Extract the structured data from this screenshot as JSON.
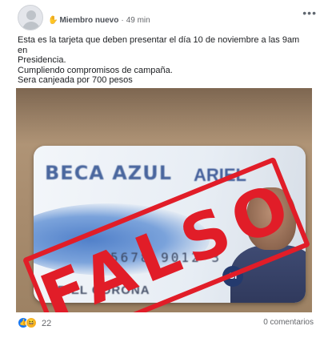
{
  "post": {
    "author_badge_icon": "hand-icon",
    "author_badge": "Miembro nuevo",
    "separator": "·",
    "timestamp": "49 min",
    "menu_icon": "more-dots-icon",
    "menu_symbol": "•••",
    "text_lines": [
      "Esta es la tarjeta que deben presentar el día 10 de noviembre a las 9am en",
      "Presidencia.",
      "Cumpliendo compromisos de campaña.",
      "Sera canjeada por 700 pesos"
    ],
    "photo": {
      "card_title": "BECA AZUL",
      "card_brand": "ARIEL",
      "card_number": "5678  9012  3",
      "card_holder": "ARIEL CORONA",
      "card_logo": "SI",
      "stamp_text": "FALSO",
      "stamp_color": "#e11d28"
    },
    "reactions": {
      "icons": [
        "like-icon",
        "haha-icon"
      ],
      "count": "22"
    },
    "comments_label": "0 comentarios"
  }
}
